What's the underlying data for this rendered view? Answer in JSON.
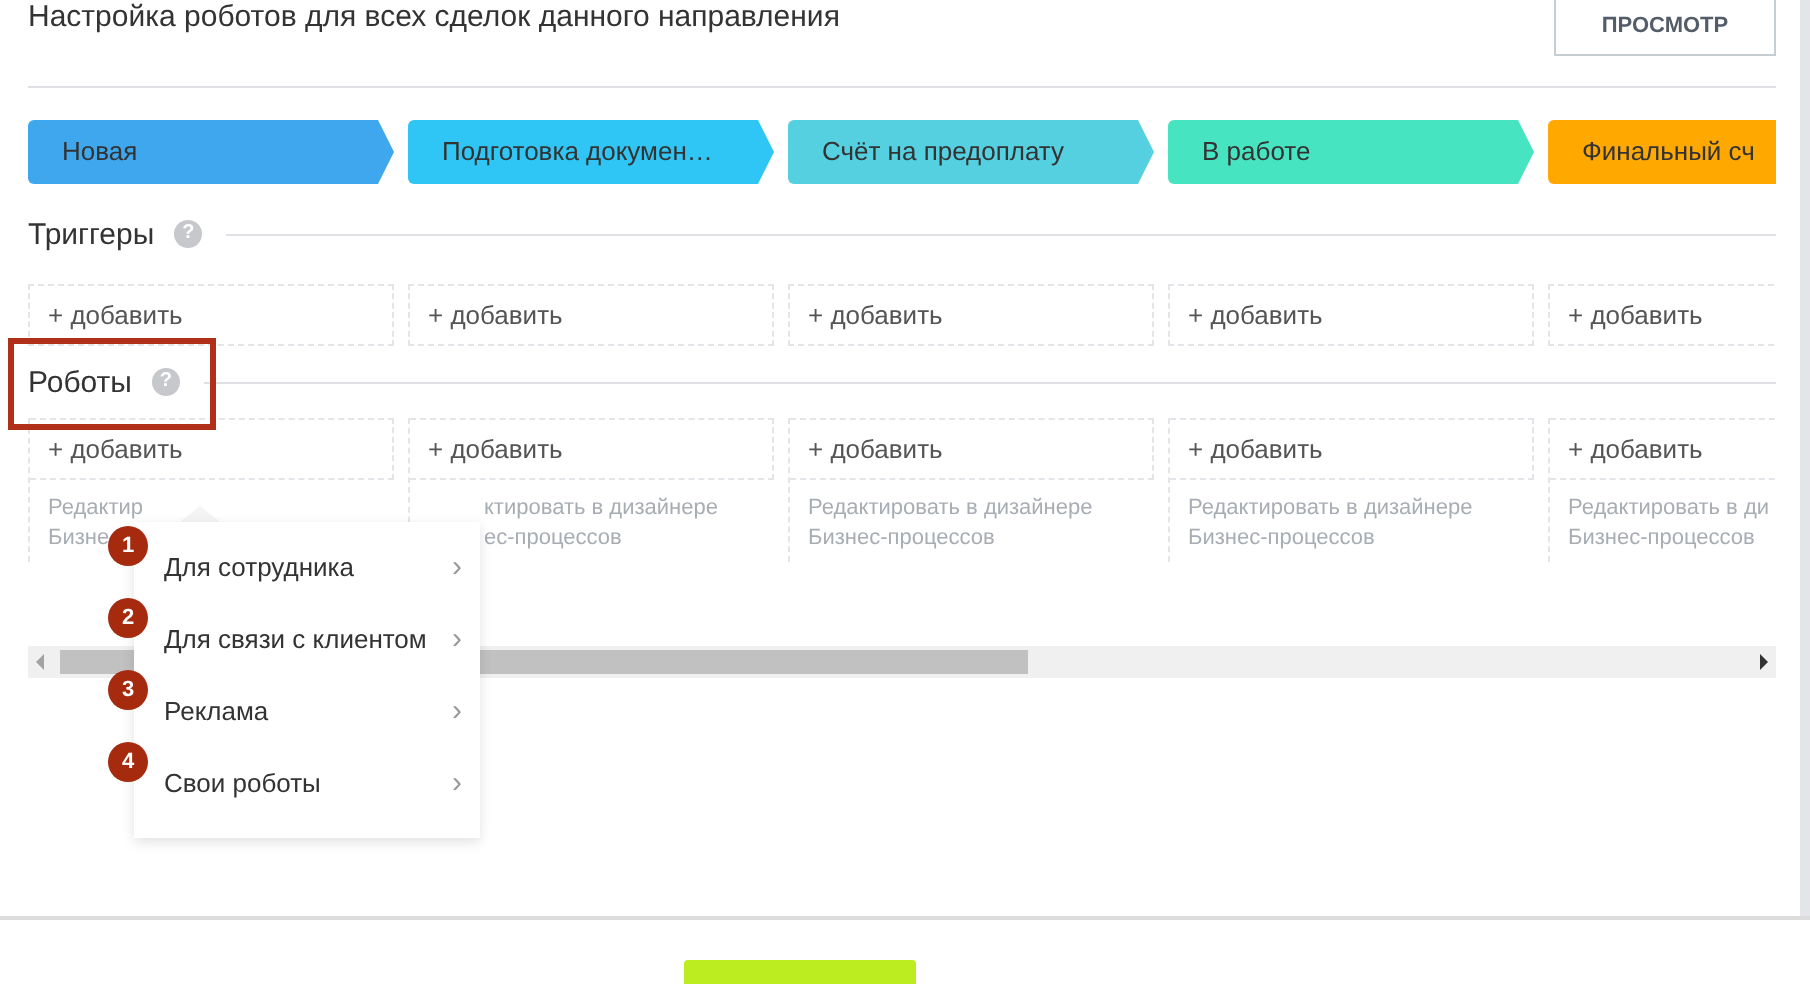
{
  "header": {
    "title": "Настройка роботов для всех сделок данного направления",
    "preview_button": "ПРОСМОТР"
  },
  "stages": [
    {
      "label": "Новая",
      "color": "#3fa7ee"
    },
    {
      "label": "Подготовка докумен…",
      "color": "#2fc6f6"
    },
    {
      "label": "Счёт на предоплату",
      "color": "#55d0e0"
    },
    {
      "label": "В работе",
      "color": "#47e4c2"
    },
    {
      "label": "Финальный сч",
      "color": "#ffa900"
    }
  ],
  "triggers": {
    "title": "Триггеры",
    "help": "?",
    "cells": [
      "+ добавить",
      "+ добавить",
      "+ добавить",
      "+ добавить",
      "+ добавить"
    ]
  },
  "robots": {
    "title": "Роботы",
    "help": "?",
    "cells": [
      {
        "add": "+ добавить",
        "note_lines": [
          "Редактир",
          "Бизне"
        ]
      },
      {
        "add": "+ добавить",
        "note_lines": [
          "ктировать в дизайнере",
          "ес-процессов"
        ]
      },
      {
        "add": "+ добавить",
        "note_lines": [
          "Редактировать в дизайнере",
          "Бизнес-процессов"
        ]
      },
      {
        "add": "+ добавить",
        "note_lines": [
          "Редактировать в дизайнере",
          "Бизнес-процессов"
        ]
      },
      {
        "add": "+ добавить",
        "note_lines": [
          "Редактировать в ди",
          "Бизнес-процессов"
        ]
      }
    ]
  },
  "menu": {
    "items": [
      {
        "number": "1",
        "label": "Для сотрудника",
        "arrow": "›"
      },
      {
        "number": "2",
        "label": "Для связи с клиентом",
        "arrow": "›"
      },
      {
        "number": "3",
        "label": "Реклама",
        "arrow": "›"
      },
      {
        "number": "4",
        "label": "Свои роботы",
        "arrow": "›"
      }
    ]
  }
}
